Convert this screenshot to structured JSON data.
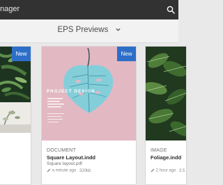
{
  "app": {
    "title": "nager"
  },
  "filter": {
    "label": "EPS Previews"
  },
  "cards": [
    {
      "badge": "New"
    },
    {
      "badge": "New",
      "type": "DOCUMENT",
      "name": "Square Layout.indd",
      "file": "Square layout.pdf",
      "modified": "a minute ago",
      "size": "320kb",
      "poster_title": "PROJECT DESIGN"
    },
    {
      "type": "IMAGE",
      "name": "Foliage.indd",
      "modified": "2 hour ago",
      "size": "3.5"
    }
  ],
  "colors": {
    "accent": "#2d6ec8",
    "titlebar": "#323232",
    "poster_bg": "#e2b8c3",
    "leaf": "#84ceda"
  }
}
